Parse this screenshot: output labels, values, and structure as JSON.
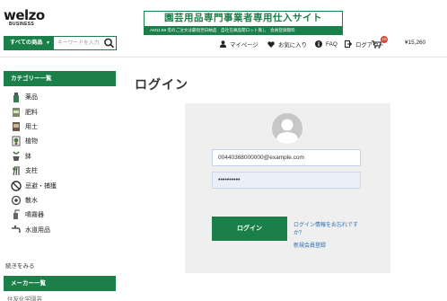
{
  "header": {
    "logo_main": "welzo",
    "logo_sub": "BUSINESS",
    "banner_title": "園芸用品専門事業者専用仕入サイト",
    "banner_strip": "AM11:59 迄のご注文は最短翌日納品　自社在庫品閉ロット無し　会員登録無料",
    "search_category": "すべての商品",
    "search_placeholder": "キーワードを入力",
    "mypage": "マイページ",
    "favorites": "お気に入り",
    "faq": "FAQ",
    "logout": "ログアウト",
    "cart_count": "10",
    "cart_total": "¥15,260"
  },
  "sidebar": {
    "category_heading": "カテゴリー一覧",
    "categories": [
      {
        "label": "薬品",
        "icon": "spray-bottle-icon"
      },
      {
        "label": "肥料",
        "icon": "fertilizer-bag-icon"
      },
      {
        "label": "用土",
        "icon": "soil-bag-icon"
      },
      {
        "label": "植物",
        "icon": "potted-plant-icon"
      },
      {
        "label": "鉢",
        "icon": "pot-icon"
      },
      {
        "label": "支柱",
        "icon": "stake-icon"
      },
      {
        "label": "忌避・捕獲",
        "icon": "no-pest-icon"
      },
      {
        "label": "散水",
        "icon": "hose-reel-icon"
      },
      {
        "label": "噴霧器",
        "icon": "sprayer-icon"
      },
      {
        "label": "水道用品",
        "icon": "faucet-icon"
      }
    ],
    "more_link": "続きをみる",
    "maker_heading": "メーカー一覧",
    "maker_cut_text": "住友化学園芸"
  },
  "main": {
    "page_title": "ログイン",
    "email_value": "00440368000000@example.com",
    "password_value": "••••••••••",
    "login_button": "ログイン",
    "forgot_link": "ログイン情報をお忘れですか？",
    "register_link": "新規会員登録"
  },
  "colors": {
    "brand_green": "#1b7f4a",
    "panel_bg": "#efefef",
    "link_blue": "#2b6fb0",
    "badge_red": "#d9473b"
  }
}
